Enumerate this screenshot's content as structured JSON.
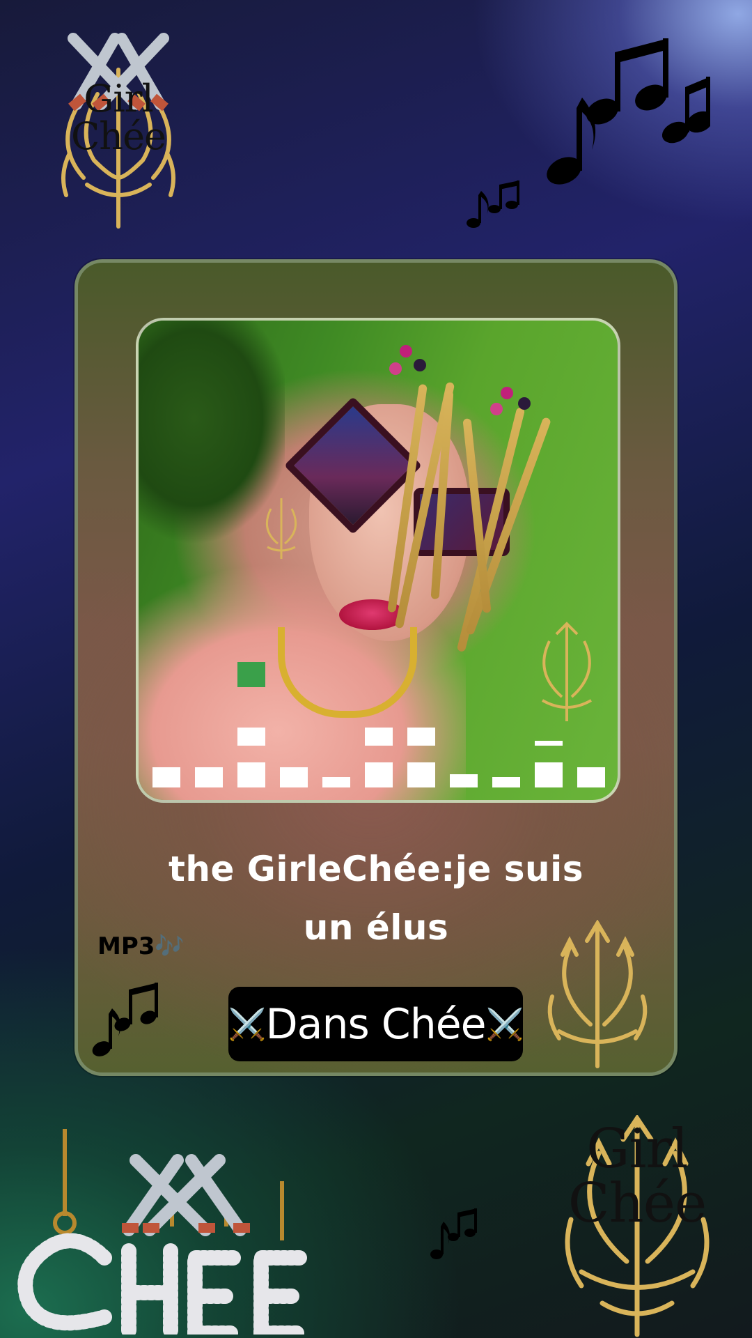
{
  "track": {
    "title_line1": "the GirleChée:je suis",
    "title_line2": "un élus"
  },
  "labels": {
    "format": "MP3🎶",
    "button": "Dans Chée",
    "button_prefix": "⚔️",
    "button_suffix": "⚔️"
  },
  "decorations": {
    "crest_text_line1": "Girl",
    "crest_text_line2": "Chée",
    "jewelry_letters": "CHEE",
    "music_notes": "🎶",
    "swords": "⚔️"
  },
  "equalizer": {
    "levels": [
      0.15,
      0.15,
      0.45,
      0.15,
      0.08,
      0.45,
      0.45,
      0.1,
      0.08,
      0.35,
      0.15
    ],
    "highlight_index": 2
  },
  "colors": {
    "gold": "#d9b45a",
    "card_border": "#7d916e",
    "button_bg": "#000000",
    "title_text": "#ffffff"
  }
}
